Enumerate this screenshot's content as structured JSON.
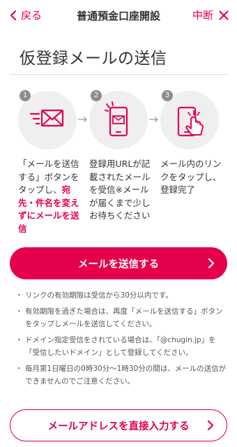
{
  "header": {
    "back_label": "戻る",
    "title": "普通預金口座開設",
    "cancel_label": "中断"
  },
  "page_title": "仮登録メールの送信",
  "steps": [
    {
      "number": "1",
      "icon": "send-mail-icon",
      "text_pre": "「メールを送信する」ボタンをタップし、",
      "text_emphasis": "宛先・件名を変えずにメールを送信",
      "text_post": ""
    },
    {
      "number": "2",
      "icon": "phone-receive-mail-icon",
      "text_pre": "登録用URLが記載されたメールを受信※メールが届くまで少しお待ちください",
      "text_emphasis": "",
      "text_post": ""
    },
    {
      "number": "3",
      "icon": "phone-tap-link-icon",
      "text_pre": "メール内のリンクをタップし、登録完了",
      "text_emphasis": "",
      "text_post": ""
    }
  ],
  "primary_button": {
    "label": "メールを送信する"
  },
  "notes": [
    "リンクの有効期限は受信から30分以内です。",
    "有効期限を過ぎた場合は、再度「メールを送信する」ボタンをタップしメールを送信してください。",
    "ドメイン指定受信をされている場合は、「@chugin.jp」を「受信したいドメイン」として登録してください。",
    "毎月第1日曜日の0時30分〜1時30分の間は、メールの送信ができませんのでご注意ください。"
  ],
  "secondary_button": {
    "label": "メールアドレスを直接入力する"
  },
  "colors": {
    "accent": "#e6004b",
    "step_bg": "#efefef",
    "step_badge": "#8d8d8d"
  }
}
